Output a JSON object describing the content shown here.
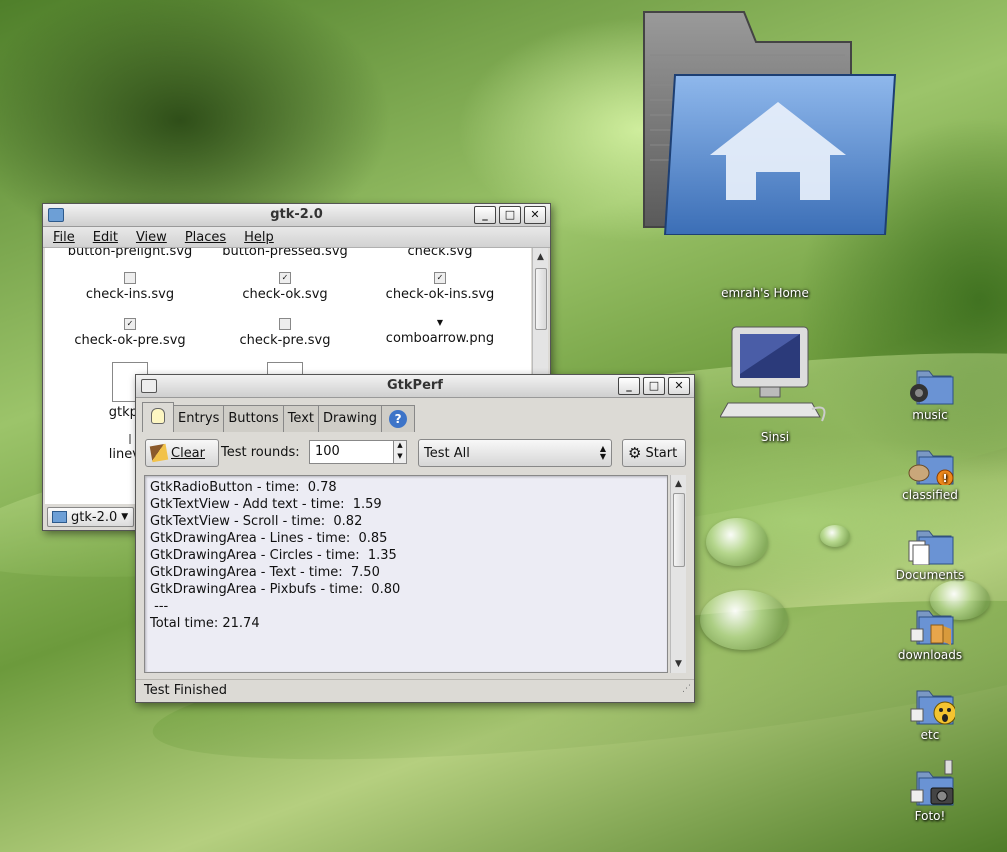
{
  "desktop": {
    "icons": [
      {
        "label": "emrah's Home"
      },
      {
        "label": "Sinsi"
      },
      {
        "label": "music"
      },
      {
        "label": "classified"
      },
      {
        "label": "Documents"
      },
      {
        "label": "downloads"
      },
      {
        "label": "etc"
      },
      {
        "label": "Foto!"
      }
    ]
  },
  "file_manager": {
    "title": "gtk-2.0",
    "menu": [
      "File",
      "Edit",
      "View",
      "Places",
      "Help"
    ],
    "files": [
      "button-prelight.svg",
      "button-pressed.svg",
      "check.svg",
      "check-ins.svg",
      "check-ok.svg",
      "check-ok-ins.svg",
      "check-ok-pre.svg",
      "check-pre.svg",
      "comboarrow.png",
      "gtkpar",
      "linev.p"
    ],
    "location": "gtk-2.0"
  },
  "gtkperf": {
    "title": "GtkPerf",
    "tabs": [
      "Entrys",
      "Buttons",
      "Text",
      "Drawing"
    ],
    "clear_label": "Clear",
    "rounds_label": "Test rounds:",
    "rounds_value": "100",
    "test_select": "Test All",
    "start_label": "Start",
    "results": [
      "GtkRadioButton - time:  0.78",
      "GtkTextView - Add text - time:  1.59",
      "GtkTextView - Scroll - time:  0.82",
      "GtkDrawingArea - Lines - time:  0.85",
      "GtkDrawingArea - Circles - time:  1.35",
      "GtkDrawingArea - Text - time:  7.50",
      "GtkDrawingArea - Pixbufs - time:  0.80",
      " ---",
      "Total time: 21.74"
    ],
    "status": "Test Finished"
  }
}
